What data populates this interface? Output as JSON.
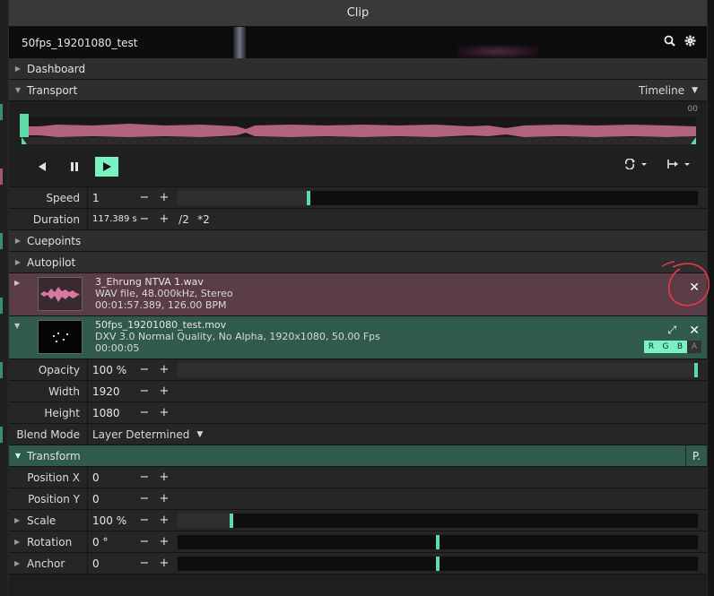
{
  "title": "Clip",
  "clip_name": "50fps_19201080_test",
  "sections": {
    "dashboard": "Dashboard",
    "transport": "Transport",
    "cuepoints": "Cuepoints",
    "autopilot": "Autopilot",
    "transform": "Transform"
  },
  "transport": {
    "mode": "Timeline",
    "timecode": "00"
  },
  "speed": {
    "label": "Speed",
    "value": "1",
    "level": 0.25
  },
  "duration": {
    "label": "Duration",
    "value": "117.389 s",
    "half": "/2",
    "double": "*2"
  },
  "audio_layer": {
    "filename": "3_Ehrung NTVA 1.wav",
    "format": "WAV file, 48.000kHz, Stereo",
    "details": "00:01:57.389, 126.00 BPM"
  },
  "video_layer": {
    "filename": "50fps_19201080_test.mov",
    "format": "DXV 3.0 Normal Quality, No Alpha, 1920x1080, 50.00 Fps",
    "details": "00:00:05",
    "channels": [
      "R",
      "G",
      "B",
      "A"
    ]
  },
  "opacity": {
    "label": "Opacity",
    "value": "100 %",
    "level": 1.0
  },
  "width": {
    "label": "Width",
    "value": "1920"
  },
  "height": {
    "label": "Height",
    "value": "1080"
  },
  "blend_mode": {
    "label": "Blend Mode",
    "value": "Layer Determined"
  },
  "position_x": {
    "label": "Position X",
    "value": "0"
  },
  "position_y": {
    "label": "Position Y",
    "value": "0"
  },
  "scale": {
    "label": "Scale",
    "value": "100 %",
    "level": 0.1
  },
  "rotation": {
    "label": "Rotation",
    "value": "0 °",
    "level": 0.5
  },
  "anchor": {
    "label": "Anchor",
    "value": "0",
    "level": 0.5
  },
  "buttons": {
    "minus": "−",
    "plus": "+",
    "p": "P."
  },
  "colors": {
    "accent": "#7bf0c0",
    "audio": "#5a3d48",
    "video": "#2f5a4c",
    "waveform": "#b0627e"
  }
}
